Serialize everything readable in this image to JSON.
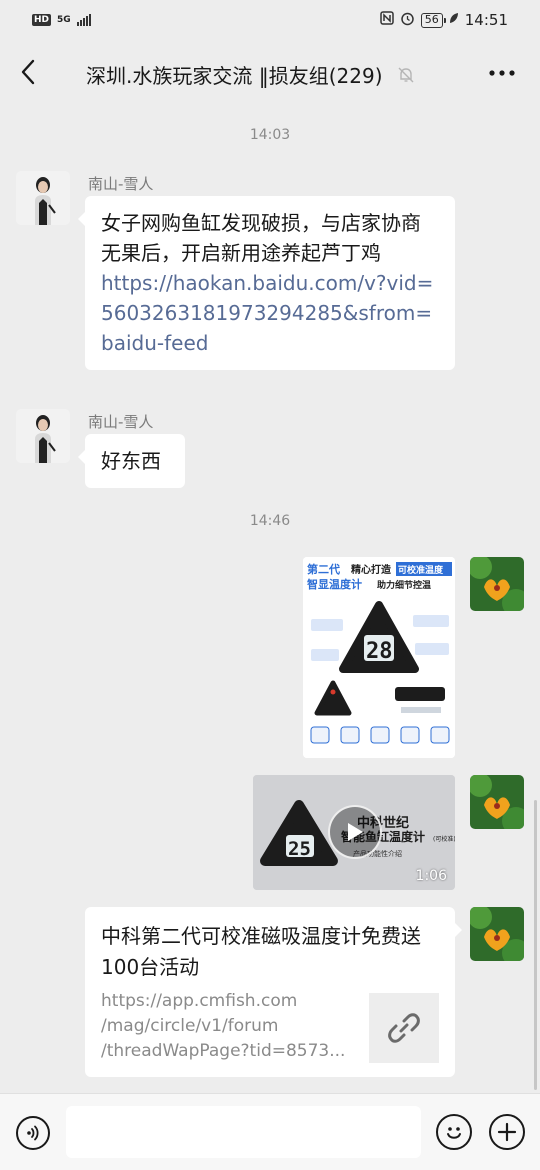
{
  "status_bar": {
    "hd_label": "HD",
    "network_label": "5G",
    "battery_level": "56",
    "time": "14:51"
  },
  "header": {
    "title": "深圳.水族玩家交流 ‖损友组(229)",
    "muted": true
  },
  "messages": [
    {
      "type": "timestamp",
      "text": "14:03"
    },
    {
      "type": "text",
      "side": "left",
      "sender": "南山-雪人",
      "text": "女子网购鱼缸发现破损，与店家协商无果后，开启新用途养起芦丁鸡",
      "link": "https://haokan.baidu.com/v?vid=5603263181973294285&sfrom=baidu-feed"
    },
    {
      "type": "text",
      "side": "left",
      "sender": "南山-雪人",
      "text": "好东西"
    },
    {
      "type": "timestamp",
      "text": "14:46"
    },
    {
      "type": "image",
      "side": "right",
      "image": {
        "heading_line1_a": "第二代",
        "heading_line1_b": "精心打造",
        "heading_line1_c": "可校准温度",
        "heading_line2_a": "智显温度计",
        "heading_line2_b": "助力细节控温",
        "display_reading": "28"
      }
    },
    {
      "type": "video",
      "side": "right",
      "video": {
        "overlay_line1": "中科世纪",
        "overlay_line2": "智能鱼缸温度计",
        "overlay_tag": "(可校准)",
        "overlay_sub": "产品功能性介绍",
        "display_reading": "25",
        "duration": "1:06"
      }
    },
    {
      "type": "link_card",
      "side": "right",
      "title": "中科第二代可校准磁吸温度计免费送100台活动",
      "url_lines": [
        "https://app.cmfish.com",
        "/mag/circle/v1/forum",
        "/threadWapPage?tid=8573..."
      ]
    }
  ],
  "input_bar": {
    "placeholder": ""
  },
  "icons": {
    "back": "chevron-left-icon",
    "mute": "bell-off-icon",
    "more": "more-dots-icon",
    "voice": "voice-icon",
    "emoji": "emoji-icon",
    "plus": "plus-icon",
    "link": "link-icon",
    "play": "play-icon"
  },
  "colors": {
    "background": "#ededed",
    "bubble": "#ffffff",
    "link": "#576b95",
    "accent_blue": "#2f6fd6"
  }
}
